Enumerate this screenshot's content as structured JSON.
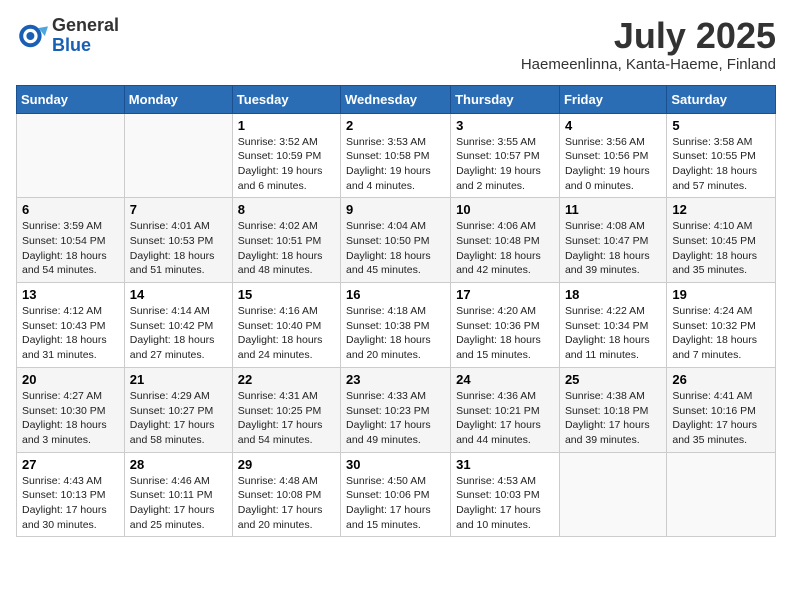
{
  "header": {
    "logo_general": "General",
    "logo_blue": "Blue",
    "month_year": "July 2025",
    "location": "Haemeenlinna, Kanta-Haeme, Finland"
  },
  "days_of_week": [
    "Sunday",
    "Monday",
    "Tuesday",
    "Wednesday",
    "Thursday",
    "Friday",
    "Saturday"
  ],
  "weeks": [
    [
      {
        "day": "",
        "info": ""
      },
      {
        "day": "",
        "info": ""
      },
      {
        "day": "1",
        "info": "Sunrise: 3:52 AM\nSunset: 10:59 PM\nDaylight: 19 hours\nand 6 minutes."
      },
      {
        "day": "2",
        "info": "Sunrise: 3:53 AM\nSunset: 10:58 PM\nDaylight: 19 hours\nand 4 minutes."
      },
      {
        "day": "3",
        "info": "Sunrise: 3:55 AM\nSunset: 10:57 PM\nDaylight: 19 hours\nand 2 minutes."
      },
      {
        "day": "4",
        "info": "Sunrise: 3:56 AM\nSunset: 10:56 PM\nDaylight: 19 hours\nand 0 minutes."
      },
      {
        "day": "5",
        "info": "Sunrise: 3:58 AM\nSunset: 10:55 PM\nDaylight: 18 hours\nand 57 minutes."
      }
    ],
    [
      {
        "day": "6",
        "info": "Sunrise: 3:59 AM\nSunset: 10:54 PM\nDaylight: 18 hours\nand 54 minutes."
      },
      {
        "day": "7",
        "info": "Sunrise: 4:01 AM\nSunset: 10:53 PM\nDaylight: 18 hours\nand 51 minutes."
      },
      {
        "day": "8",
        "info": "Sunrise: 4:02 AM\nSunset: 10:51 PM\nDaylight: 18 hours\nand 48 minutes."
      },
      {
        "day": "9",
        "info": "Sunrise: 4:04 AM\nSunset: 10:50 PM\nDaylight: 18 hours\nand 45 minutes."
      },
      {
        "day": "10",
        "info": "Sunrise: 4:06 AM\nSunset: 10:48 PM\nDaylight: 18 hours\nand 42 minutes."
      },
      {
        "day": "11",
        "info": "Sunrise: 4:08 AM\nSunset: 10:47 PM\nDaylight: 18 hours\nand 39 minutes."
      },
      {
        "day": "12",
        "info": "Sunrise: 4:10 AM\nSunset: 10:45 PM\nDaylight: 18 hours\nand 35 minutes."
      }
    ],
    [
      {
        "day": "13",
        "info": "Sunrise: 4:12 AM\nSunset: 10:43 PM\nDaylight: 18 hours\nand 31 minutes."
      },
      {
        "day": "14",
        "info": "Sunrise: 4:14 AM\nSunset: 10:42 PM\nDaylight: 18 hours\nand 27 minutes."
      },
      {
        "day": "15",
        "info": "Sunrise: 4:16 AM\nSunset: 10:40 PM\nDaylight: 18 hours\nand 24 minutes."
      },
      {
        "day": "16",
        "info": "Sunrise: 4:18 AM\nSunset: 10:38 PM\nDaylight: 18 hours\nand 20 minutes."
      },
      {
        "day": "17",
        "info": "Sunrise: 4:20 AM\nSunset: 10:36 PM\nDaylight: 18 hours\nand 15 minutes."
      },
      {
        "day": "18",
        "info": "Sunrise: 4:22 AM\nSunset: 10:34 PM\nDaylight: 18 hours\nand 11 minutes."
      },
      {
        "day": "19",
        "info": "Sunrise: 4:24 AM\nSunset: 10:32 PM\nDaylight: 18 hours\nand 7 minutes."
      }
    ],
    [
      {
        "day": "20",
        "info": "Sunrise: 4:27 AM\nSunset: 10:30 PM\nDaylight: 18 hours\nand 3 minutes."
      },
      {
        "day": "21",
        "info": "Sunrise: 4:29 AM\nSunset: 10:27 PM\nDaylight: 17 hours\nand 58 minutes."
      },
      {
        "day": "22",
        "info": "Sunrise: 4:31 AM\nSunset: 10:25 PM\nDaylight: 17 hours\nand 54 minutes."
      },
      {
        "day": "23",
        "info": "Sunrise: 4:33 AM\nSunset: 10:23 PM\nDaylight: 17 hours\nand 49 minutes."
      },
      {
        "day": "24",
        "info": "Sunrise: 4:36 AM\nSunset: 10:21 PM\nDaylight: 17 hours\nand 44 minutes."
      },
      {
        "day": "25",
        "info": "Sunrise: 4:38 AM\nSunset: 10:18 PM\nDaylight: 17 hours\nand 39 minutes."
      },
      {
        "day": "26",
        "info": "Sunrise: 4:41 AM\nSunset: 10:16 PM\nDaylight: 17 hours\nand 35 minutes."
      }
    ],
    [
      {
        "day": "27",
        "info": "Sunrise: 4:43 AM\nSunset: 10:13 PM\nDaylight: 17 hours\nand 30 minutes."
      },
      {
        "day": "28",
        "info": "Sunrise: 4:46 AM\nSunset: 10:11 PM\nDaylight: 17 hours\nand 25 minutes."
      },
      {
        "day": "29",
        "info": "Sunrise: 4:48 AM\nSunset: 10:08 PM\nDaylight: 17 hours\nand 20 minutes."
      },
      {
        "day": "30",
        "info": "Sunrise: 4:50 AM\nSunset: 10:06 PM\nDaylight: 17 hours\nand 15 minutes."
      },
      {
        "day": "31",
        "info": "Sunrise: 4:53 AM\nSunset: 10:03 PM\nDaylight: 17 hours\nand 10 minutes."
      },
      {
        "day": "",
        "info": ""
      },
      {
        "day": "",
        "info": ""
      }
    ]
  ]
}
